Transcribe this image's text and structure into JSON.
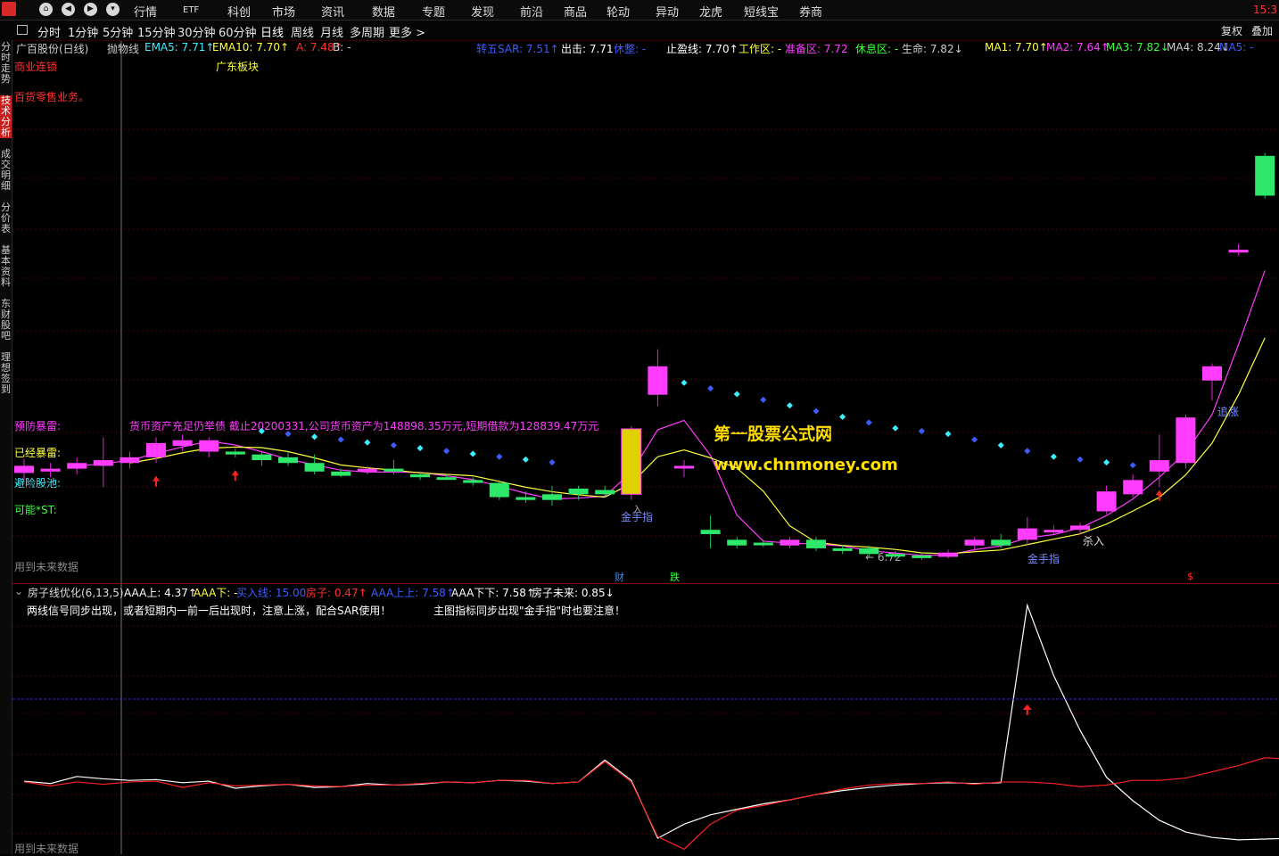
{
  "topmenu": {
    "items": [
      "行情",
      "ETF",
      "科创",
      "市场",
      "资讯",
      "数据",
      "专题",
      "发现",
      "前沿",
      "商品",
      "轮动",
      "异动",
      "龙虎",
      "短线宝",
      "券商"
    ],
    "clock": "15:3"
  },
  "periodbar": {
    "periods": [
      "分时",
      "1分钟",
      "5分钟",
      "15分钟",
      "30分钟",
      "60分钟",
      "日线",
      "周线",
      "月线",
      "多周期",
      "更多 >"
    ],
    "active_index": 6,
    "fuquan": "复权",
    "diejia": "叠加"
  },
  "sidebar": {
    "tabs": [
      "分时走势",
      "技术分析",
      "成交明细",
      "分价表",
      "基本资料",
      "东财股吧",
      "理想签到"
    ],
    "active_index": 1
  },
  "main_chart": {
    "legend": [
      {
        "text": "广百股份(日线)",
        "color": "#cccccc"
      },
      {
        "text": "抛物线",
        "color": "#cccccc"
      },
      {
        "text": "EMA5: 7.71↑",
        "color": "#3cf0ff"
      },
      {
        "text": "EMA10: 7.70↑",
        "color": "#ffff40"
      },
      {
        "text": "A: 7.48↑",
        "color": "#ff3030"
      },
      {
        "text": "B: -",
        "color": "#cccccc"
      },
      {
        "text": "转五SAR: 7.51↑",
        "color": "#3c5cff"
      },
      {
        "text": "出击: 7.71",
        "color": "#ffffff"
      },
      {
        "text": "休整: -",
        "color": "#3c5cff"
      },
      {
        "text": "止盈线: 7.70↑",
        "color": "#ffffff"
      },
      {
        "text": "工作区: -",
        "color": "#ffff40"
      },
      {
        "text": "准备区: 7.72",
        "color": "#ff3cff"
      },
      {
        "text": "休息区: -",
        "color": "#3cff3c"
      },
      {
        "text": "生命: 7.82↓",
        "color": "#cccccc"
      },
      {
        "text": "MA1: 7.70↑",
        "color": "#ffff40"
      },
      {
        "text": "MA2: 7.64↑",
        "color": "#ff3cff"
      },
      {
        "text": "MA3: 7.82↓",
        "color": "#3cff3c"
      },
      {
        "text": "MA4: 8.24↓",
        "color": "#cccccc"
      },
      {
        "text": "MA5: -",
        "color": "#3c5cff"
      }
    ],
    "industry": "商业连锁",
    "region": "广东板块",
    "business": "百货零售业务。",
    "warning_label": "预防暴雷:",
    "warning_text": "货币资产充足仍举债 截止20200331,公司货币资产为148898.35万元,短期借款为128839.47万元",
    "exploded_label": "已经暴雷:",
    "avoid_label": "避险股池:",
    "st_label": "可能*ST:",
    "future_note": "用到未来数据",
    "watermark_title": "第一股票公式网",
    "watermark_url": "www.chnmoney.com",
    "annot_jinshouzhi_1": "金手指",
    "annot_ru": "入",
    "annot_jinshouzhi_2": "金手指",
    "annot_sharu": "杀入",
    "annot_zhuizhang": "追涨",
    "annot_low": "← 6.72",
    "marker_cai": "财",
    "marker_die": "跌",
    "marker_s": "$",
    "candles": [
      {
        "o": 7.65,
        "c": 7.7,
        "h": 7.75,
        "l": 7.6
      },
      {
        "o": 7.66,
        "c": 7.68,
        "h": 7.72,
        "l": 7.62
      },
      {
        "o": 7.68,
        "c": 7.72,
        "h": 7.76,
        "l": 7.64
      },
      {
        "o": 7.7,
        "c": 7.74,
        "h": 7.9,
        "l": 7.55
      },
      {
        "o": 7.72,
        "c": 7.76,
        "h": 7.8,
        "l": 7.68
      },
      {
        "o": 7.76,
        "c": 7.86,
        "h": 7.9,
        "l": 7.72
      },
      {
        "o": 7.84,
        "c": 7.88,
        "h": 7.92,
        "l": 7.8
      },
      {
        "o": 7.8,
        "c": 7.88,
        "h": 7.9,
        "l": 7.76
      },
      {
        "o": 7.8,
        "c": 7.78,
        "h": 7.82,
        "l": 7.76
      },
      {
        "o": 7.78,
        "c": 7.74,
        "h": 7.8,
        "l": 7.7
      },
      {
        "o": 7.76,
        "c": 7.72,
        "h": 7.8,
        "l": 7.7
      },
      {
        "o": 7.72,
        "c": 7.66,
        "h": 7.78,
        "l": 7.64
      },
      {
        "o": 7.66,
        "c": 7.63,
        "h": 7.68,
        "l": 7.62
      },
      {
        "o": 7.66,
        "c": 7.68,
        "h": 7.7,
        "l": 7.64
      },
      {
        "o": 7.68,
        "c": 7.66,
        "h": 7.74,
        "l": 7.64
      },
      {
        "o": 7.64,
        "c": 7.62,
        "h": 7.66,
        "l": 7.6
      },
      {
        "o": 7.62,
        "c": 7.61,
        "h": 7.64,
        "l": 7.6
      },
      {
        "o": 7.6,
        "c": 7.58,
        "h": 7.62,
        "l": 7.56
      },
      {
        "o": 7.58,
        "c": 7.48,
        "h": 7.6,
        "l": 7.46
      },
      {
        "o": 7.48,
        "c": 7.46,
        "h": 7.52,
        "l": 7.44
      },
      {
        "o": 7.5,
        "c": 7.46,
        "h": 7.56,
        "l": 7.42
      },
      {
        "o": 7.54,
        "c": 7.5,
        "h": 7.56,
        "l": 7.46
      },
      {
        "o": 7.53,
        "c": 7.5,
        "h": 7.56,
        "l": 7.48
      },
      {
        "o": 7.5,
        "c": 7.96,
        "h": 7.98,
        "l": 7.46
      },
      {
        "o": 8.2,
        "c": 8.4,
        "h": 8.52,
        "l": 8.12
      },
      {
        "o": 7.7,
        "c": 7.7,
        "h": 7.74,
        "l": 7.62
      },
      {
        "o": 7.25,
        "c": 7.22,
        "h": 7.35,
        "l": 7.12
      },
      {
        "o": 7.18,
        "c": 7.14,
        "h": 7.2,
        "l": 7.12
      },
      {
        "o": 7.16,
        "c": 7.15,
        "h": 7.18,
        "l": 7.13
      },
      {
        "o": 7.14,
        "c": 7.18,
        "h": 7.2,
        "l": 7.12
      },
      {
        "o": 7.18,
        "c": 7.12,
        "h": 7.2,
        "l": 7.1
      },
      {
        "o": 7.12,
        "c": 7.11,
        "h": 7.14,
        "l": 7.08
      },
      {
        "o": 7.12,
        "c": 7.08,
        "h": 7.14,
        "l": 7.06
      },
      {
        "o": 7.08,
        "c": 7.07,
        "h": 7.1,
        "l": 7.05
      },
      {
        "o": 7.07,
        "c": 7.06,
        "h": 7.09,
        "l": 7.04
      },
      {
        "o": 7.06,
        "c": 7.09,
        "h": 7.11,
        "l": 7.05
      },
      {
        "o": 7.14,
        "c": 7.18,
        "h": 7.2,
        "l": 7.1
      },
      {
        "o": 7.18,
        "c": 7.14,
        "h": 7.22,
        "l": 7.12
      },
      {
        "o": 7.18,
        "c": 7.26,
        "h": 7.34,
        "l": 7.14
      },
      {
        "o": 7.24,
        "c": 7.25,
        "h": 7.28,
        "l": 7.22
      },
      {
        "o": 7.25,
        "c": 7.28,
        "h": 7.3,
        "l": 7.22
      },
      {
        "o": 7.38,
        "c": 7.52,
        "h": 7.56,
        "l": 7.36
      },
      {
        "o": 7.5,
        "c": 7.6,
        "h": 7.64,
        "l": 7.48
      },
      {
        "o": 7.66,
        "c": 7.74,
        "h": 7.92,
        "l": 7.55
      },
      {
        "o": 7.72,
        "c": 8.04,
        "h": 8.06,
        "l": 7.68
      },
      {
        "o": 8.3,
        "c": 8.4,
        "h": 8.42,
        "l": 8.16
      },
      {
        "o": 9.2,
        "c": 9.22,
        "h": 9.26,
        "l": 9.18
      },
      {
        "o": 9.88,
        "c": 9.6,
        "h": 9.9,
        "l": 9.58
      }
    ],
    "sar_points": [
      null,
      null,
      null,
      null,
      null,
      null,
      null,
      null,
      null,
      7.94,
      7.92,
      7.9,
      7.88,
      7.86,
      7.84,
      7.82,
      7.8,
      7.78,
      7.76,
      7.74,
      7.72,
      null,
      null,
      null,
      null,
      8.28,
      8.24,
      8.2,
      8.16,
      8.12,
      8.08,
      8.04,
      8.0,
      7.96,
      7.94,
      7.92,
      7.88,
      7.84,
      7.8,
      7.76,
      7.74,
      7.72,
      7.7,
      null,
      null,
      null,
      null,
      null
    ]
  },
  "sub_chart": {
    "indicator": "房子线优化(6,13,5)",
    "legend": [
      {
        "text": "AAA上: 4.37↑",
        "color": "#ffffff"
      },
      {
        "text": "AAA下: -",
        "color": "#ffff40"
      },
      {
        "text": "买入线: 15.00",
        "color": "#3c5cff"
      },
      {
        "text": "房子: 0.47↑",
        "color": "#ff3030"
      },
      {
        "text": "AAA上上: 7.58↑",
        "color": "#3c5cff"
      },
      {
        "text": "AAA下下: 7.58↑",
        "color": "#ffffff"
      },
      {
        "text": "房子未来: 0.85↓",
        "color": "#ffffff"
      }
    ],
    "note1": "两线信号同步出现，或者短期内一前一后出现时，注意上涨，配合SAR使用！",
    "note2": "主图指标同步出现\"金手指\"时也要注意！",
    "future_note": "用到未来数据",
    "white_line": [
      4.5,
      4.2,
      5.1,
      4.8,
      4.6,
      4.7,
      4.3,
      4.5,
      3.6,
      3.9,
      4.1,
      3.7,
      3.8,
      4.2,
      4.0,
      4.1,
      4.4,
      4.3,
      4.6,
      4.5,
      4.2,
      4.4,
      7.2,
      4.6,
      -2.8,
      -1.0,
      0.2,
      0.9,
      1.6,
      2.1,
      2.8,
      3.3,
      3.7,
      4.0,
      4.2,
      4.3,
      4.2,
      4.3,
      27.0,
      18.0,
      11.0,
      5.0,
      2.0,
      -0.5,
      -2.0,
      -2.7,
      -3.0,
      -2.9,
      -2.8
    ],
    "red_line": [
      4.4,
      3.9,
      4.4,
      4.1,
      4.4,
      4.5,
      3.7,
      4.3,
      3.9,
      4.0,
      4.1,
      3.9,
      3.8,
      4.0,
      4.0,
      4.2,
      4.4,
      4.3,
      4.6,
      4.6,
      4.2,
      4.4,
      7.0,
      4.4,
      -2.6,
      -4.2,
      -1.0,
      0.8,
      1.4,
      2.1,
      2.8,
      3.5,
      4.0,
      4.2,
      4.2,
      4.4,
      4.1,
      4.4,
      4.4,
      4.2,
      3.8,
      4.0,
      4.6,
      4.6,
      4.9,
      5.7,
      6.5,
      7.5,
      7.3
    ],
    "buy_line": 15.0
  }
}
